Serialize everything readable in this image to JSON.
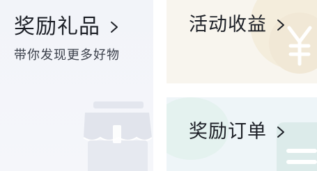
{
  "cards": {
    "gifts": {
      "title": "奖励礼品",
      "subtitle": "带你发现更多好物",
      "icon": "shop-icon"
    },
    "earnings": {
      "title": "活动收益",
      "icon": "yuan-coin-icon"
    },
    "orders": {
      "title": "奖励订单",
      "icon": "order-list-icon"
    }
  },
  "colors": {
    "gifts_bg": "#f2f4f9",
    "earnings_bg": "#f8f5ee",
    "orders_bg": "#eef5f8",
    "text": "#1c1f26"
  }
}
